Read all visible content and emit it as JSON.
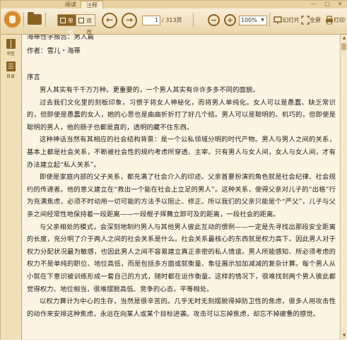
{
  "tabs": [
    {
      "label": "阅读"
    },
    {
      "label": "注释"
    }
  ],
  "toolbar": {
    "single_page_label": "单页",
    "double_page_label": "双页",
    "current_page": "1",
    "total_pages": "/ 313页",
    "zoom_value": "100%",
    "slideshow_label": "幻灯片",
    "fullscreen_label": "全屏",
    "print_label": "打印"
  },
  "sidebar": {
    "items": [
      {
        "label": "书签",
        "icon": "bookmark-icon"
      },
      {
        "label": "目录",
        "icon": "toc-icon"
      }
    ]
  },
  "document": {
    "title_line": "海蒂性学报告：男人篇",
    "author_line": "作者：雪儿・海蒂",
    "section": "序言",
    "paragraphs": [
      "男人其实有千千万万种。更重要的，一个男人其实有许许多多不同的面貌。",
      "过去我们文化里的刻板印象，习惯于将女人神秘化，而将男人单纯化。女人可以是愚蠢、缺乏常识的，但即使是愚蠢的女人，她的心思也是曲曲折折打了好几个结。男人可以是聪明的、机巧的，但即使是聪明的男人，他的肠子也都是直的，透明的藏不住东西。",
      "这种神话当然有其相应的社会结构背景：是一个公私领域分明的时代产物。男人与男人之间的关系，基本上都是社会关系，不断被社会性的规约考虑所穿透、主宰。只有男人与女人间，女人与女人间，才有办法建立起“私人关系”。",
      "即使是家庭内部的父子关系，都充满了社会介入的印迹。父亲首要扮演的角色就是社会纪律、社会规约的传递者。他的意义建立在“救出一个能在社会上立足的男人”。这种关系，使得父亲对儿子的“出格”行为充满焦虑，必须不时动用一切可能的方法予以阻止、修正。所以我们的父亲只能是个“严父”，儿子与父亲之间经常性地保持着一段距离——一段棍子挥舞立即可及的距离，一段社会的距离。",
      "与父亲相处的模式，会深刻地制约男人与其他男人彼此互动的惯例——一定是先寻找出那段安全距离的长度，充分明了介于两人之间的社会关系是什么。社会关系最核心的东西就是权力高下。因此男人对于权力分配状况最为敏感，也因此男人之间不容易建立真正亲密的私人情谊。男人所能感知、所必须考虑的权力不是单纯的职位、地位高低，而是包括多方面或就衡量、象征展示加加减减的复杂计算。每个男人从小就在下意识被训练形成一套自己的方式，随时都在运作衡量。这样的情况下，很难找到两个男人彼此都觉得权力、地位相当，很难摆脱高低、竞争的心态，平等相处。",
      "以权力算计为中心的生存，当然是很辛苦的。几乎无时无刻摆脱得掉防卫性的焦虑，很多人用攻击性的动作来安排这种焦虑，永远在向某人或某个目标进袭。攻击可以忘掉焦虑，却忘不掉疲惫的感觉。"
    ]
  },
  "colors": {
    "accent": "#8a6324",
    "background": "#fbf4e2",
    "toolbar": "#ead6aa"
  }
}
